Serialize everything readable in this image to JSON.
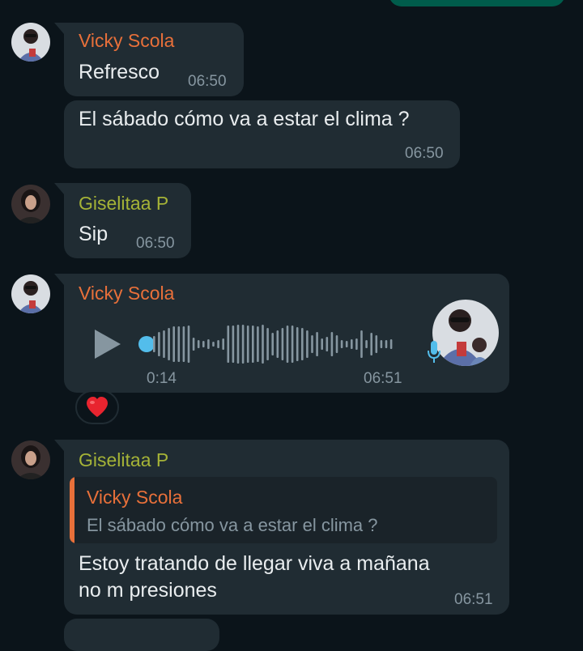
{
  "colors": {
    "background": "#0b141a",
    "bubble_in": "#202c33",
    "bubble_out": "#005c4b",
    "vicky_name": "#e8703a",
    "giselita_name": "#a5b337",
    "timestamp": "#8696a0",
    "voice_accent": "#53bdeb",
    "heart": "#e8242f"
  },
  "messages": [
    {
      "sender": "Vicky Scola",
      "text": "Refresco",
      "time": "06:50"
    },
    {
      "text": "El sábado cómo va a estar el clima ?",
      "time": "06:50"
    },
    {
      "sender": "Giselitaa P",
      "text": "Sip",
      "time": "06:50"
    },
    {
      "sender": "Vicky Scola",
      "type": "voice",
      "duration": "0:14",
      "time": "06:51",
      "reaction": "heart",
      "played_fraction": 0
    },
    {
      "sender": "Giselitaa P",
      "quote": {
        "sender": "Vicky Scola",
        "text": "El sábado cómo va a estar el clima ?"
      },
      "text_line1": "Estoy tratando de llegar viva a mañana",
      "text_line2": "no m presiones",
      "time": "06:51"
    }
  ]
}
